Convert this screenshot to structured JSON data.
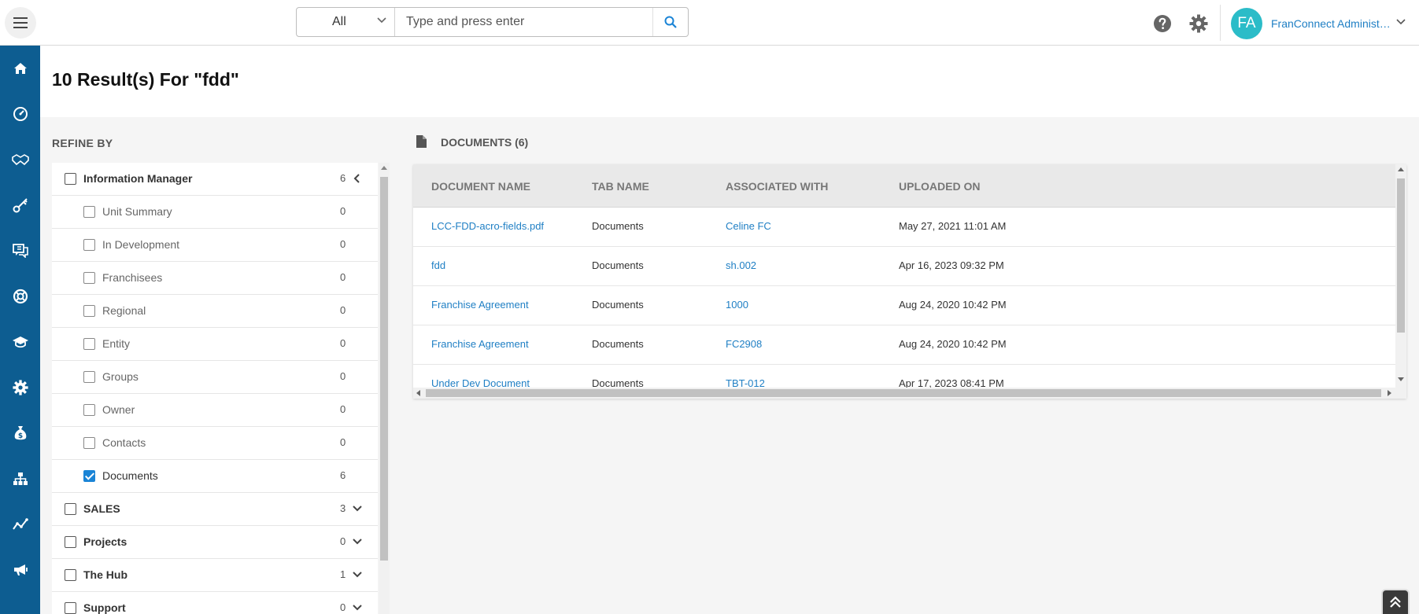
{
  "header": {
    "search_scope": "All",
    "search_placeholder": "Type and press enter",
    "user_initials": "FA",
    "user_name": "FranConnect Administr..."
  },
  "page": {
    "title": "10 Result(s) For \"fdd\""
  },
  "refine": {
    "title": "REFINE BY",
    "items": [
      {
        "label": "Information Manager",
        "count": "6",
        "level": "top",
        "checked": false,
        "chevron": "left"
      },
      {
        "label": "Unit Summary",
        "count": "0",
        "level": "sub",
        "checked": false
      },
      {
        "label": "In Development",
        "count": "0",
        "level": "sub",
        "checked": false
      },
      {
        "label": "Franchisees",
        "count": "0",
        "level": "sub",
        "checked": false
      },
      {
        "label": "Regional",
        "count": "0",
        "level": "sub",
        "checked": false
      },
      {
        "label": "Entity",
        "count": "0",
        "level": "sub",
        "checked": false
      },
      {
        "label": "Groups",
        "count": "0",
        "level": "sub",
        "checked": false
      },
      {
        "label": "Owner",
        "count": "0",
        "level": "sub",
        "checked": false
      },
      {
        "label": "Contacts",
        "count": "0",
        "level": "sub",
        "checked": false
      },
      {
        "label": "Documents",
        "count": "6",
        "level": "sub",
        "checked": true
      },
      {
        "label": "SALES",
        "count": "3",
        "level": "top",
        "checked": false,
        "chevron": "down"
      },
      {
        "label": "Projects",
        "count": "0",
        "level": "top",
        "checked": false,
        "chevron": "down"
      },
      {
        "label": "The Hub",
        "count": "1",
        "level": "top",
        "checked": false,
        "chevron": "down"
      },
      {
        "label": "Support",
        "count": "0",
        "level": "top",
        "checked": false,
        "chevron": "down"
      }
    ]
  },
  "documents": {
    "title": "DOCUMENTS (6)",
    "columns": [
      "DOCUMENT NAME",
      "TAB NAME",
      "ASSOCIATED WITH",
      "UPLOADED ON"
    ],
    "rows": [
      {
        "name": "LCC-FDD-acro-fields.pdf",
        "tab": "Documents",
        "associated": "Celine FC",
        "uploaded": "May 27, 2021 11:01 AM"
      },
      {
        "name": "fdd",
        "tab": "Documents",
        "associated": "sh.002",
        "uploaded": "Apr 16, 2023 09:32 PM"
      },
      {
        "name": "Franchise Agreement",
        "tab": "Documents",
        "associated": "1000",
        "uploaded": "Aug 24, 2020 10:42 PM"
      },
      {
        "name": "Franchise Agreement",
        "tab": "Documents",
        "associated": "FC2908",
        "uploaded": "Aug 24, 2020 10:42 PM"
      },
      {
        "name": "Under Dev Document",
        "tab": "Documents",
        "associated": "TBT-012",
        "uploaded": "Apr 17, 2023 08:41 PM"
      }
    ]
  },
  "colors": {
    "sidebar": "#0d5d91",
    "link": "#1f7fc4",
    "avatar": "#2bbcc8",
    "checkbox_checked": "#1a84d6"
  },
  "icons": {
    "sidebar": [
      "home-icon",
      "dashboard-icon",
      "handshake-icon",
      "key-icon",
      "chat-icon",
      "support-icon",
      "graduation-cap-icon",
      "gear-icon",
      "money-bag-icon",
      "org-chart-icon",
      "analytics-icon",
      "megaphone-icon"
    ]
  }
}
